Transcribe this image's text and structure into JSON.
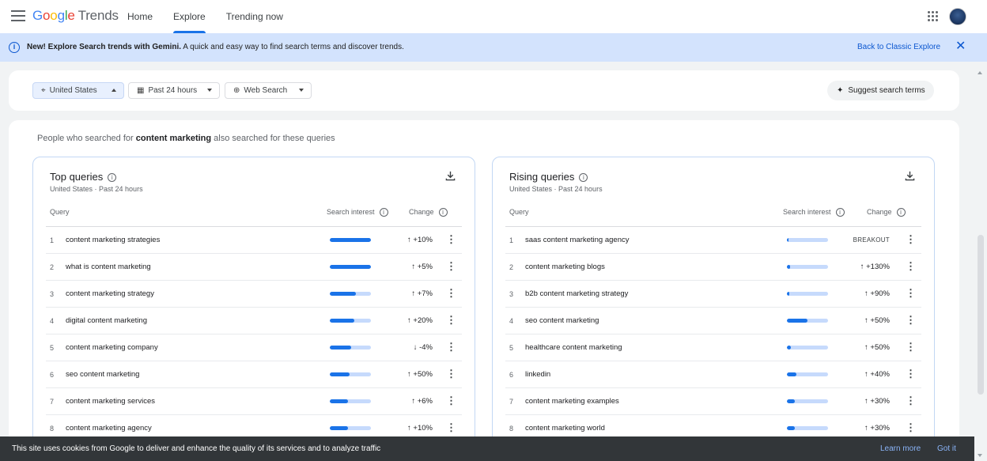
{
  "header": {
    "logo_google": [
      "G",
      "o",
      "o",
      "g",
      "l",
      "e"
    ],
    "logo_trends": "Trends",
    "nav": [
      "Home",
      "Explore",
      "Trending now"
    ],
    "active_nav": "Explore"
  },
  "banner": {
    "bold": "New! Explore Search trends with Gemini.",
    "text": " A quick and easy way to find search terms and discover trends.",
    "link": "Back to Classic Explore",
    "close": "✕"
  },
  "filters": {
    "location": "United States",
    "time": "Past 24 hours",
    "property": "Web Search",
    "suggest": "Suggest search terms"
  },
  "intro": {
    "prefix": "People who searched for ",
    "term": "content marketing",
    "suffix": " also searched for these queries"
  },
  "top_queries": {
    "title": "Top queries",
    "subtitle": "United States · Past 24 hours",
    "headers": {
      "query": "Query",
      "interest": "Search interest",
      "change": "Change"
    },
    "rows": [
      {
        "rank": "1",
        "query": "content marketing strategies",
        "interest": 100,
        "change": "↑ +10%"
      },
      {
        "rank": "2",
        "query": "what is content marketing",
        "interest": 100,
        "change": "↑ +5%"
      },
      {
        "rank": "3",
        "query": "content marketing strategy",
        "interest": 64,
        "change": "↑ +7%"
      },
      {
        "rank": "4",
        "query": "digital content marketing",
        "interest": 60,
        "change": "↑ +20%"
      },
      {
        "rank": "5",
        "query": "content marketing company",
        "interest": 52,
        "change": "↓ -4%"
      },
      {
        "rank": "6",
        "query": "seo content marketing",
        "interest": 48,
        "change": "↑ +50%"
      },
      {
        "rank": "7",
        "query": "content marketing services",
        "interest": 44,
        "change": "↑ +6%"
      },
      {
        "rank": "8",
        "query": "content marketing agency",
        "interest": 44,
        "change": "↑ +10%"
      }
    ]
  },
  "rising_queries": {
    "title": "Rising queries",
    "subtitle": "United States · Past 24 hours",
    "headers": {
      "query": "Query",
      "interest": "Search interest",
      "change": "Change"
    },
    "rows": [
      {
        "rank": "1",
        "query": "saas content marketing agency",
        "interest": 3,
        "change": "BREAKOUT"
      },
      {
        "rank": "2",
        "query": "content marketing blogs",
        "interest": 8,
        "change": "↑ +130%"
      },
      {
        "rank": "3",
        "query": "b2b content marketing strategy",
        "interest": 6,
        "change": "↑ +90%"
      },
      {
        "rank": "4",
        "query": "seo content marketing",
        "interest": 50,
        "change": "↑ +50%"
      },
      {
        "rank": "5",
        "query": "healthcare content marketing",
        "interest": 10,
        "change": "↑ +50%"
      },
      {
        "rank": "6",
        "query": "linkedin",
        "interest": 24,
        "change": "↑ +40%"
      },
      {
        "rank": "7",
        "query": "content marketing examples",
        "interest": 20,
        "change": "↑ +30%"
      },
      {
        "rank": "8",
        "query": "content marketing world",
        "interest": 20,
        "change": "↑ +30%"
      }
    ]
  },
  "cookie": {
    "text": "This site uses cookies from Google to deliver and enhance the quality of its services and to analyze traffic",
    "learn_more": "Learn more",
    "got_it": "Got it"
  },
  "colors": {
    "accent": "#1a73e8",
    "banner": "#d3e3fd",
    "bar_bg": "#c6dafc"
  }
}
